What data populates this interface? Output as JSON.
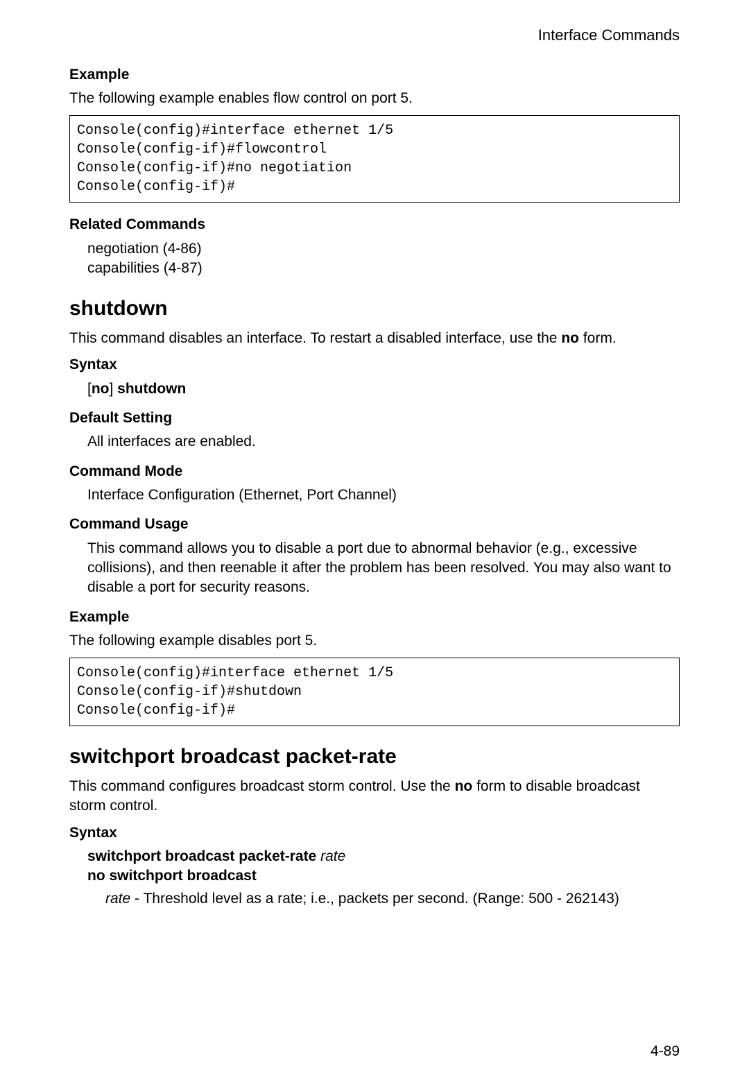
{
  "header": {
    "title": "Interface Commands"
  },
  "sec1": {
    "example_label": "Example",
    "example_intro": "The following example enables flow control on port 5.",
    "code": "Console(config)#interface ethernet 1/5\nConsole(config-if)#flowcontrol\nConsole(config-if)#no negotiation\nConsole(config-if)#",
    "related_label": "Related Commands",
    "related_line1": "negotiation (4-86)",
    "related_line2": "capabilities (4-87)"
  },
  "sec2": {
    "heading": "shutdown",
    "desc_pre": "This command disables an interface. To restart a disabled interface, use the ",
    "desc_bold": "no",
    "desc_post": " form.",
    "syntax_label": "Syntax",
    "syntax_open": "[",
    "syntax_bold1": "no",
    "syntax_close": "] ",
    "syntax_bold2": "shutdown",
    "default_label": "Default Setting",
    "default_text": "All interfaces are enabled.",
    "mode_label": "Command Mode",
    "mode_text": "Interface Configuration (Ethernet, Port Channel)",
    "usage_label": "Command Usage",
    "usage_text": "This command allows you to disable a port due to abnormal behavior (e.g., excessive collisions), and then reenable it after the problem has been resolved. You may also want to disable a port for security reasons.",
    "example_label": "Example",
    "example_intro": "The following example disables port 5.",
    "code": "Console(config)#interface ethernet 1/5\nConsole(config-if)#shutdown\nConsole(config-if)#"
  },
  "sec3": {
    "heading": "switchport broadcast packet-rate",
    "desc_pre": "This command configures broadcast storm control. Use the ",
    "desc_bold": "no",
    "desc_post": " form to disable broadcast storm control.",
    "syntax_label": "Syntax",
    "syntax_line1_bold": "switchport broadcast packet-rate ",
    "syntax_line1_italic": "rate",
    "syntax_line2_bold": "no switchport broadcast",
    "param_italic": "rate",
    "param_text": " - Threshold level as a rate; i.e., packets per second. (Range: 500 - 262143)"
  },
  "page_number": "4-89"
}
